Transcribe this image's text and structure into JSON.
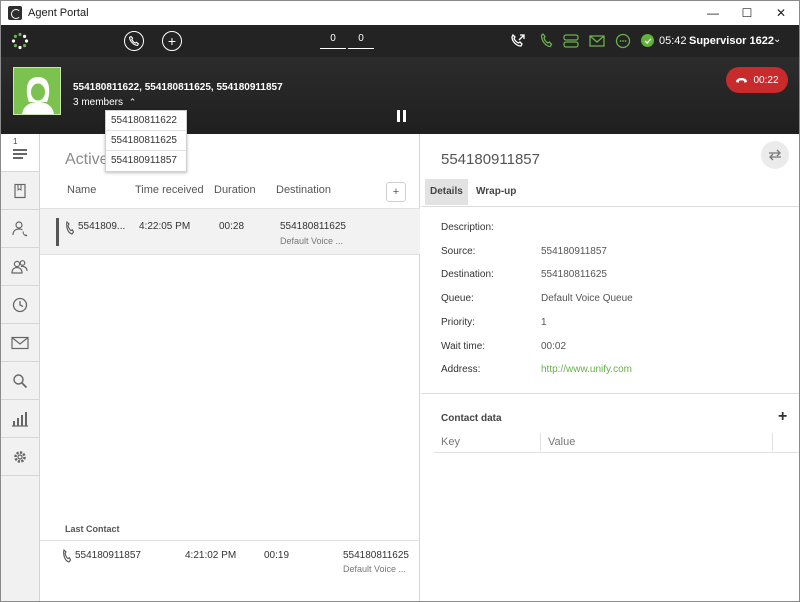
{
  "window": {
    "title": "Agent Portal",
    "minimize": "—",
    "maximize": "☐",
    "close": "✕"
  },
  "toolbar": {
    "add_icon": "+",
    "counter_1": "0",
    "counter_2": "0",
    "time": "05:42",
    "user": "Supervisor 1622",
    "user_menu": "⌄",
    "status_color": "#5fb336"
  },
  "call": {
    "participants": "554180811622, 554180811625, 554180911857",
    "members_label": "3 members",
    "members_toggle": "⌃",
    "duration": "00:22",
    "members": [
      "554180811622",
      "554180811625",
      "554180911857"
    ]
  },
  "sidenav": {
    "queue_badge": "1"
  },
  "active": {
    "title": "Active",
    "add_column": "+",
    "columns": [
      "Name",
      "Time received",
      "Duration",
      "Destination"
    ],
    "row": {
      "name": "5541809...",
      "time": "4:22:05 PM",
      "duration": "00:28",
      "destination": "554180811625",
      "queue": "Default Voice ..."
    },
    "last_contact_title": "Last Contact",
    "last": {
      "name": "554180911857",
      "time": "4:21:02 PM",
      "duration": "00:19",
      "destination": "554180811625",
      "queue": "Default Voice ..."
    }
  },
  "details": {
    "title": "554180911857",
    "tabs": [
      "Details",
      "Wrap-up"
    ],
    "fields": [
      {
        "label": "Description:",
        "value": ""
      },
      {
        "label": "Source:",
        "value": "554180911857"
      },
      {
        "label": "Destination:",
        "value": "554180811625"
      },
      {
        "label": "Queue:",
        "value": "Default Voice Queue"
      },
      {
        "label": "Priority:",
        "value": "1"
      },
      {
        "label": "Wait time:",
        "value": "00:02"
      },
      {
        "label": "Address:",
        "value": "http://www.unify.com"
      }
    ],
    "contact_data_title": "Contact data",
    "contact_add": "+",
    "contact_columns": [
      "Key",
      "Value"
    ]
  },
  "colors": {
    "accent": "#6ab04c",
    "hangup": "#c82b2b",
    "toolbar_bg": "#232323"
  }
}
